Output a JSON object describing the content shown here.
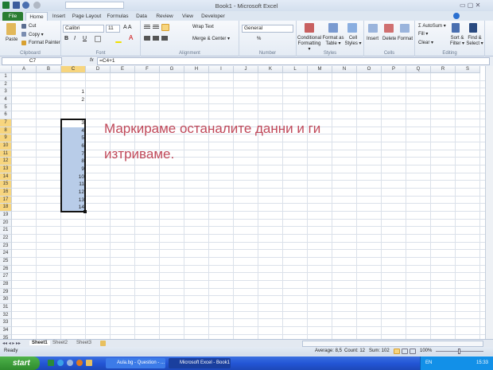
{
  "window": {
    "title": "Book1 - Microsoft Excel"
  },
  "tabs": [
    "File",
    "Home",
    "Insert",
    "Page Layout",
    "Formulas",
    "Data",
    "Review",
    "View",
    "Developer"
  ],
  "ribbon": {
    "clipboard": {
      "label": "Clipboard",
      "paste": "Paste",
      "cut": "Cut",
      "copy": "Copy ▾",
      "format_painter": "Format Painter"
    },
    "font": {
      "label": "Font",
      "name": "Calibri",
      "size": "11"
    },
    "alignment": {
      "label": "Alignment",
      "wrap": "Wrap Text",
      "merge": "Merge & Center ▾"
    },
    "number": {
      "label": "Number",
      "format": "General",
      "percent": "%"
    },
    "styles": {
      "label": "Styles",
      "conditional": "Conditional Formatting ▾",
      "format_table": "Format as Table ▾",
      "cell_styles": "Cell Styles ▾"
    },
    "cells": {
      "label": "Cells",
      "insert": "Insert",
      "delete": "Delete",
      "format": "Format"
    },
    "editing": {
      "label": "Editing",
      "autosum": "Σ AutoSum ▾",
      "fill": "Fill ▾",
      "clear": "Clear ▾",
      "sort": "Sort & Filter ▾",
      "find": "Find & Select ▾"
    }
  },
  "formula_bar": {
    "name_box": "C7",
    "fx": "fx",
    "formula": "=C4+1"
  },
  "columns": [
    "A",
    "B",
    "C",
    "D",
    "E",
    "F",
    "G",
    "H",
    "I",
    "J",
    "K",
    "L",
    "M",
    "N",
    "O",
    "P",
    "Q",
    "R",
    "S"
  ],
  "selected_column": "C",
  "row_count": 35,
  "selected_rows": [
    7,
    18
  ],
  "cells": [
    {
      "row": 3,
      "value": "1"
    },
    {
      "row": 4,
      "value": "2"
    },
    {
      "row": 7,
      "value": "3"
    },
    {
      "row": 8,
      "value": "4"
    },
    {
      "row": 9,
      "value": "5"
    },
    {
      "row": 10,
      "value": "6"
    },
    {
      "row": 11,
      "value": "7"
    },
    {
      "row": 12,
      "value": "8"
    },
    {
      "row": 13,
      "value": "9"
    },
    {
      "row": 14,
      "value": "10"
    },
    {
      "row": 15,
      "value": "11"
    },
    {
      "row": 16,
      "value": "12"
    },
    {
      "row": 17,
      "value": "13"
    },
    {
      "row": 18,
      "value": "14"
    }
  ],
  "annotation": {
    "line1": "Маркираме останалите данни и ги",
    "line2": "изтриваме.",
    "color": "#c0495a"
  },
  "sheets": [
    "Sheet1",
    "Sheet2",
    "Sheet3"
  ],
  "status": {
    "ready": "Ready",
    "average": "Average: 8,5",
    "count": "Count: 12",
    "sum": "Sum: 102",
    "zoom": "100%"
  },
  "taskbar": {
    "start": "start",
    "tasks": [
      "Aula.bg - Question - ...",
      "Microsoft Excel - Book1"
    ],
    "lang": "EN",
    "clock": "15:33"
  }
}
